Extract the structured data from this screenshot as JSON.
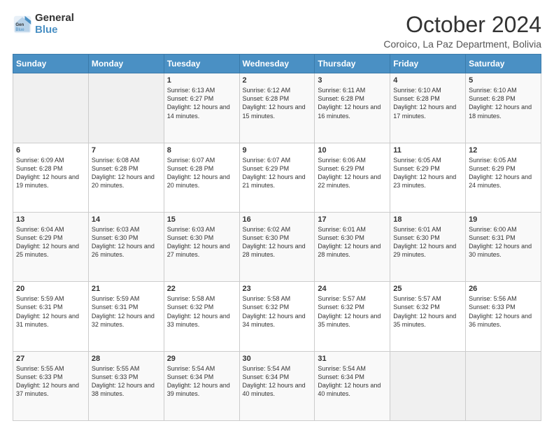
{
  "header": {
    "logo_line1": "General",
    "logo_line2": "Blue",
    "title": "October 2024",
    "subtitle": "Coroico, La Paz Department, Bolivia"
  },
  "days_of_week": [
    "Sunday",
    "Monday",
    "Tuesday",
    "Wednesday",
    "Thursday",
    "Friday",
    "Saturday"
  ],
  "weeks": [
    [
      {
        "day": "",
        "info": ""
      },
      {
        "day": "",
        "info": ""
      },
      {
        "day": "1",
        "info": "Sunrise: 6:13 AM\nSunset: 6:27 PM\nDaylight: 12 hours and 14 minutes."
      },
      {
        "day": "2",
        "info": "Sunrise: 6:12 AM\nSunset: 6:28 PM\nDaylight: 12 hours and 15 minutes."
      },
      {
        "day": "3",
        "info": "Sunrise: 6:11 AM\nSunset: 6:28 PM\nDaylight: 12 hours and 16 minutes."
      },
      {
        "day": "4",
        "info": "Sunrise: 6:10 AM\nSunset: 6:28 PM\nDaylight: 12 hours and 17 minutes."
      },
      {
        "day": "5",
        "info": "Sunrise: 6:10 AM\nSunset: 6:28 PM\nDaylight: 12 hours and 18 minutes."
      }
    ],
    [
      {
        "day": "6",
        "info": "Sunrise: 6:09 AM\nSunset: 6:28 PM\nDaylight: 12 hours and 19 minutes."
      },
      {
        "day": "7",
        "info": "Sunrise: 6:08 AM\nSunset: 6:28 PM\nDaylight: 12 hours and 20 minutes."
      },
      {
        "day": "8",
        "info": "Sunrise: 6:07 AM\nSunset: 6:28 PM\nDaylight: 12 hours and 20 minutes."
      },
      {
        "day": "9",
        "info": "Sunrise: 6:07 AM\nSunset: 6:29 PM\nDaylight: 12 hours and 21 minutes."
      },
      {
        "day": "10",
        "info": "Sunrise: 6:06 AM\nSunset: 6:29 PM\nDaylight: 12 hours and 22 minutes."
      },
      {
        "day": "11",
        "info": "Sunrise: 6:05 AM\nSunset: 6:29 PM\nDaylight: 12 hours and 23 minutes."
      },
      {
        "day": "12",
        "info": "Sunrise: 6:05 AM\nSunset: 6:29 PM\nDaylight: 12 hours and 24 minutes."
      }
    ],
    [
      {
        "day": "13",
        "info": "Sunrise: 6:04 AM\nSunset: 6:29 PM\nDaylight: 12 hours and 25 minutes."
      },
      {
        "day": "14",
        "info": "Sunrise: 6:03 AM\nSunset: 6:30 PM\nDaylight: 12 hours and 26 minutes."
      },
      {
        "day": "15",
        "info": "Sunrise: 6:03 AM\nSunset: 6:30 PM\nDaylight: 12 hours and 27 minutes."
      },
      {
        "day": "16",
        "info": "Sunrise: 6:02 AM\nSunset: 6:30 PM\nDaylight: 12 hours and 28 minutes."
      },
      {
        "day": "17",
        "info": "Sunrise: 6:01 AM\nSunset: 6:30 PM\nDaylight: 12 hours and 28 minutes."
      },
      {
        "day": "18",
        "info": "Sunrise: 6:01 AM\nSunset: 6:30 PM\nDaylight: 12 hours and 29 minutes."
      },
      {
        "day": "19",
        "info": "Sunrise: 6:00 AM\nSunset: 6:31 PM\nDaylight: 12 hours and 30 minutes."
      }
    ],
    [
      {
        "day": "20",
        "info": "Sunrise: 5:59 AM\nSunset: 6:31 PM\nDaylight: 12 hours and 31 minutes."
      },
      {
        "day": "21",
        "info": "Sunrise: 5:59 AM\nSunset: 6:31 PM\nDaylight: 12 hours and 32 minutes."
      },
      {
        "day": "22",
        "info": "Sunrise: 5:58 AM\nSunset: 6:32 PM\nDaylight: 12 hours and 33 minutes."
      },
      {
        "day": "23",
        "info": "Sunrise: 5:58 AM\nSunset: 6:32 PM\nDaylight: 12 hours and 34 minutes."
      },
      {
        "day": "24",
        "info": "Sunrise: 5:57 AM\nSunset: 6:32 PM\nDaylight: 12 hours and 35 minutes."
      },
      {
        "day": "25",
        "info": "Sunrise: 5:57 AM\nSunset: 6:32 PM\nDaylight: 12 hours and 35 minutes."
      },
      {
        "day": "26",
        "info": "Sunrise: 5:56 AM\nSunset: 6:33 PM\nDaylight: 12 hours and 36 minutes."
      }
    ],
    [
      {
        "day": "27",
        "info": "Sunrise: 5:55 AM\nSunset: 6:33 PM\nDaylight: 12 hours and 37 minutes."
      },
      {
        "day": "28",
        "info": "Sunrise: 5:55 AM\nSunset: 6:33 PM\nDaylight: 12 hours and 38 minutes."
      },
      {
        "day": "29",
        "info": "Sunrise: 5:54 AM\nSunset: 6:34 PM\nDaylight: 12 hours and 39 minutes."
      },
      {
        "day": "30",
        "info": "Sunrise: 5:54 AM\nSunset: 6:34 PM\nDaylight: 12 hours and 40 minutes."
      },
      {
        "day": "31",
        "info": "Sunrise: 5:54 AM\nSunset: 6:34 PM\nDaylight: 12 hours and 40 minutes."
      },
      {
        "day": "",
        "info": ""
      },
      {
        "day": "",
        "info": ""
      }
    ]
  ]
}
